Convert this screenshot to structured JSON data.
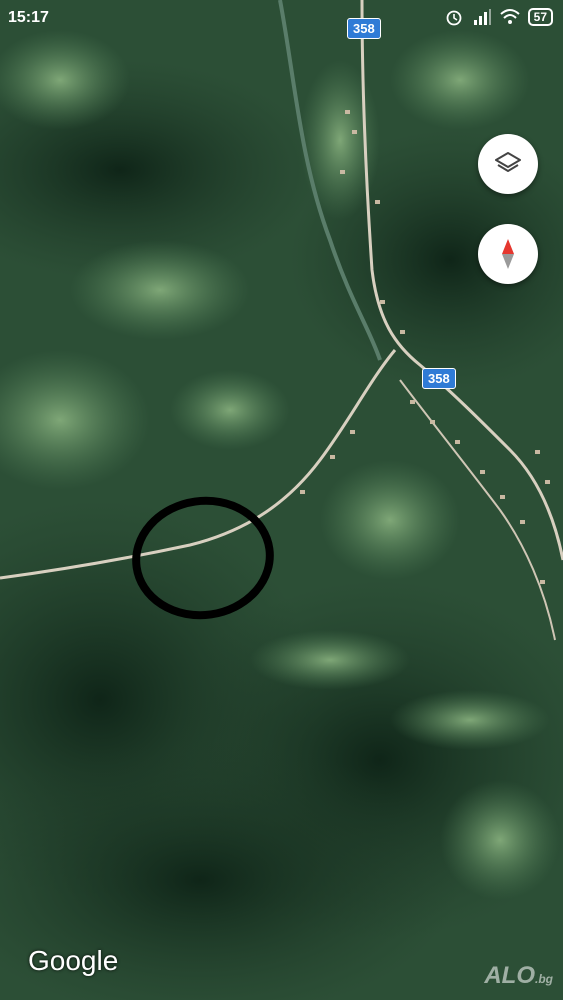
{
  "status_bar": {
    "time": "15:17",
    "battery": "57",
    "icons": [
      "alarm-icon",
      "signal-icon",
      "wifi-icon"
    ]
  },
  "map": {
    "type": "satellite",
    "road_labels": [
      "358",
      "358"
    ],
    "colors": {
      "forest_dark": "#1f3a28",
      "forest": "#2f5a3a",
      "meadow": "#6f9a6a",
      "road": "#d8d0c0",
      "shield": "#2f7bd6",
      "marker_circle": "#000000"
    }
  },
  "controls": {
    "layers_icon": "layers-icon",
    "compass_icon": "compass-icon"
  },
  "attribution": {
    "provider": "Google"
  },
  "watermark": {
    "brand": "ALO",
    "suffix": ".bg"
  }
}
